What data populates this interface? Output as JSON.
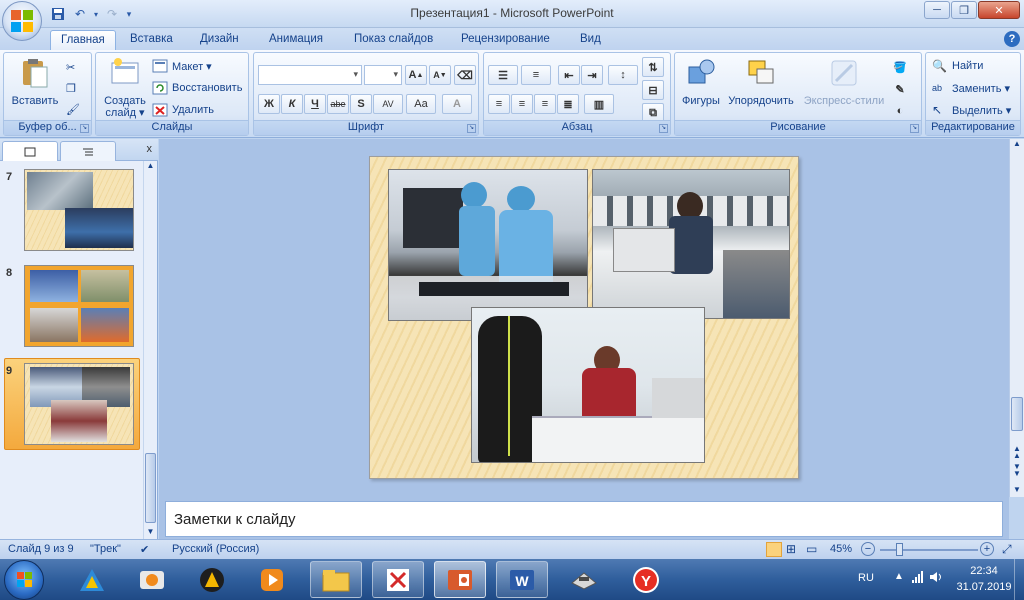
{
  "window": {
    "title": "Презентация1 - Microsoft PowerPoint",
    "controls": [
      "─",
      "❐",
      "✕"
    ]
  },
  "tabs": [
    "Главная",
    "Вставка",
    "Дизайн",
    "Анимация",
    "Показ слайдов",
    "Рецензирование",
    "Вид"
  ],
  "ribbon": {
    "clipboard": {
      "label": "Буфер об...",
      "paste": "Вставить"
    },
    "slides": {
      "label": "Слайды",
      "new_slide": "Создать слайд ▾",
      "layout": "Макет ▾",
      "reset": "Восстановить",
      "delete": "Удалить"
    },
    "font": {
      "label": "Шрифт",
      "bold": "Ж",
      "italic": "К",
      "underline": "Ч",
      "strike": "abe",
      "shadow": "S",
      "spacing": "AV",
      "case": "Aa",
      "color": "A"
    },
    "paragraph": {
      "label": "Абзац"
    },
    "drawing": {
      "label": "Рисование",
      "shapes": "Фигуры",
      "arrange": "Упорядочить",
      "quick_styles": "Экспресс-стили"
    },
    "editing": {
      "label": "Редактирование",
      "find": "Найти",
      "replace": "Заменить ▾",
      "select": "Выделить ▾"
    }
  },
  "thumbnails": [
    {
      "number": "7"
    },
    {
      "number": "8"
    },
    {
      "number": "9",
      "selected": true
    }
  ],
  "notes": {
    "placeholder": "Заметки к слайду"
  },
  "status": {
    "slide": "Слайд 9 из 9",
    "theme": "\"Трек\"",
    "language": "Русский (Россия)",
    "zoom": "45%"
  },
  "taskbar": {
    "lang": "RU",
    "time": "22:34",
    "date": "31.07.2019"
  },
  "colors": {
    "ribbon_text": "#15428b",
    "accent_orange": "#f4a93d",
    "slide_bg": "#f6e4b6"
  }
}
